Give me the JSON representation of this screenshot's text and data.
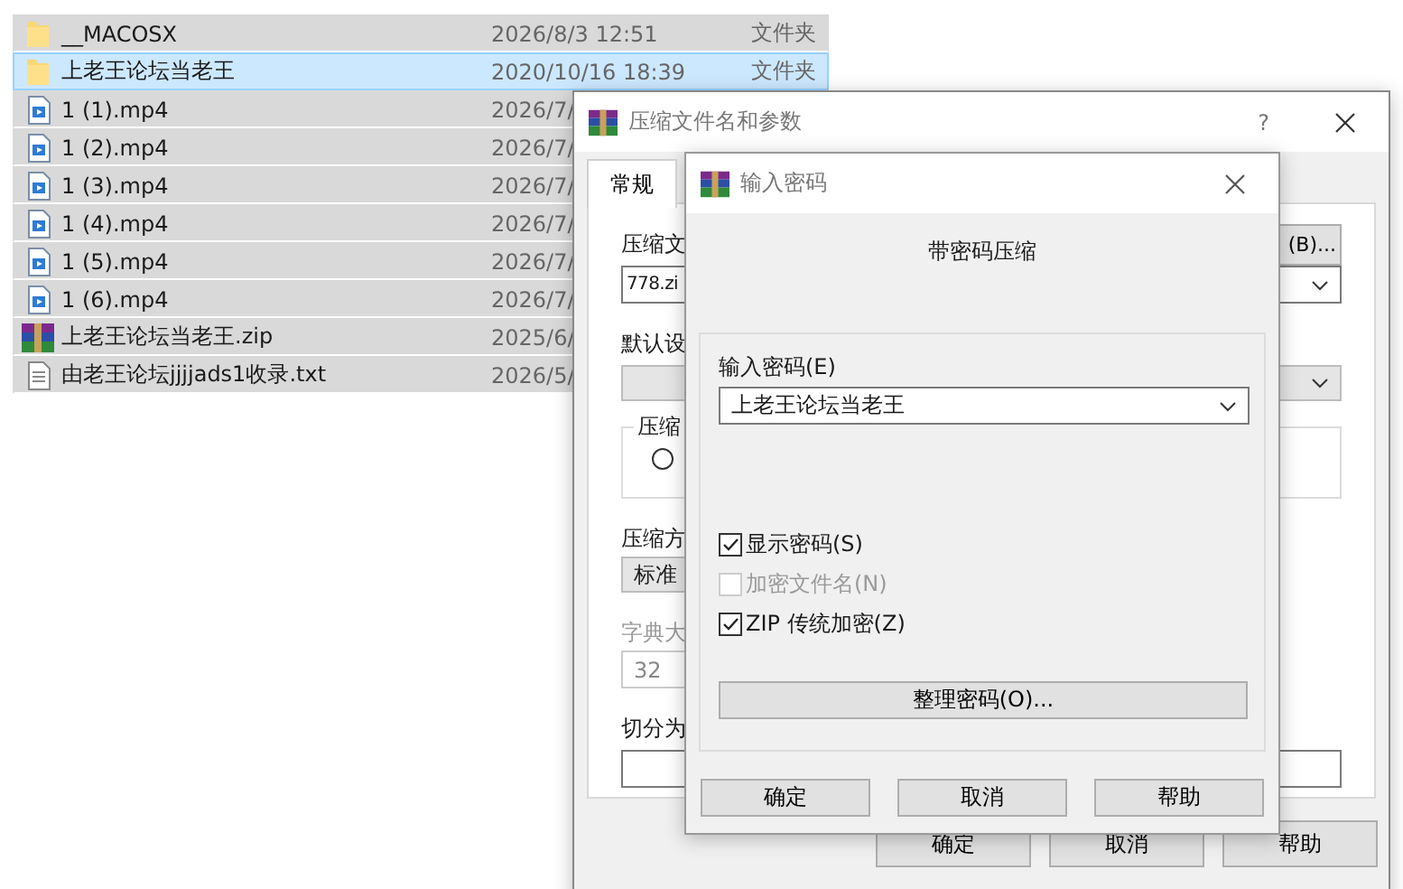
{
  "file_list": {
    "rows": [
      {
        "kind": "folder",
        "name": "__MACOSX",
        "date": "2026/8/3 12:51",
        "type": "文件夹",
        "selected": false
      },
      {
        "kind": "folder",
        "name": "上老王论坛当老王",
        "date": "2020/10/16 18:39",
        "type": "文件夹",
        "selected": true
      },
      {
        "kind": "video",
        "name": "1 (1).mp4",
        "date": "2026/7/",
        "selected": false
      },
      {
        "kind": "video",
        "name": "1 (2).mp4",
        "date": "2026/7/",
        "selected": false
      },
      {
        "kind": "video",
        "name": "1 (3).mp4",
        "date": "2026/7/",
        "selected": false
      },
      {
        "kind": "video",
        "name": "1 (4).mp4",
        "date": "2026/7/",
        "selected": false
      },
      {
        "kind": "video",
        "name": "1 (5).mp4",
        "date": "2026/7/",
        "selected": false
      },
      {
        "kind": "video",
        "name": "1 (6).mp4",
        "date": "2026/7/",
        "selected": false
      },
      {
        "kind": "archive",
        "name": "上老王论坛当老王.zip",
        "date": "2025/6/",
        "selected": false
      },
      {
        "kind": "text",
        "name": "由老王论坛jjjjads1收录.txt",
        "date": "2026/5/",
        "selected": false
      }
    ]
  },
  "compress_dialog": {
    "title": "压缩文件名和参数",
    "help_button": "?",
    "tabs": [
      {
        "label": "常规",
        "selected": true
      }
    ],
    "archive_label": "压缩文",
    "browse_button": "(B)...",
    "archive_name": "778.zi",
    "profile_label": "默认设",
    "format_group_label": "压缩",
    "format_radio": {
      "selected": false
    },
    "method_label": "压缩方",
    "method_value": "标准",
    "dictionary": {
      "label": "字典大",
      "value": "32",
      "disabled": true
    },
    "split_label": "切分为",
    "buttons": [
      "确定",
      "取消",
      "帮助"
    ]
  },
  "password_dialog": {
    "title": "输入密码",
    "heading": "带密码压缩",
    "password_label": "输入密码(E)",
    "password_value": "上老王论坛当老王",
    "options": [
      {
        "label": "显示密码(S)",
        "checked": true,
        "disabled": false
      },
      {
        "label": "加密文件名(N)",
        "checked": false,
        "disabled": true
      },
      {
        "label": "ZIP 传统加密(Z)",
        "checked": true,
        "disabled": false
      }
    ],
    "organize_button": "整理密码(O)...",
    "buttons": [
      "确定",
      "取消",
      "帮助"
    ]
  }
}
